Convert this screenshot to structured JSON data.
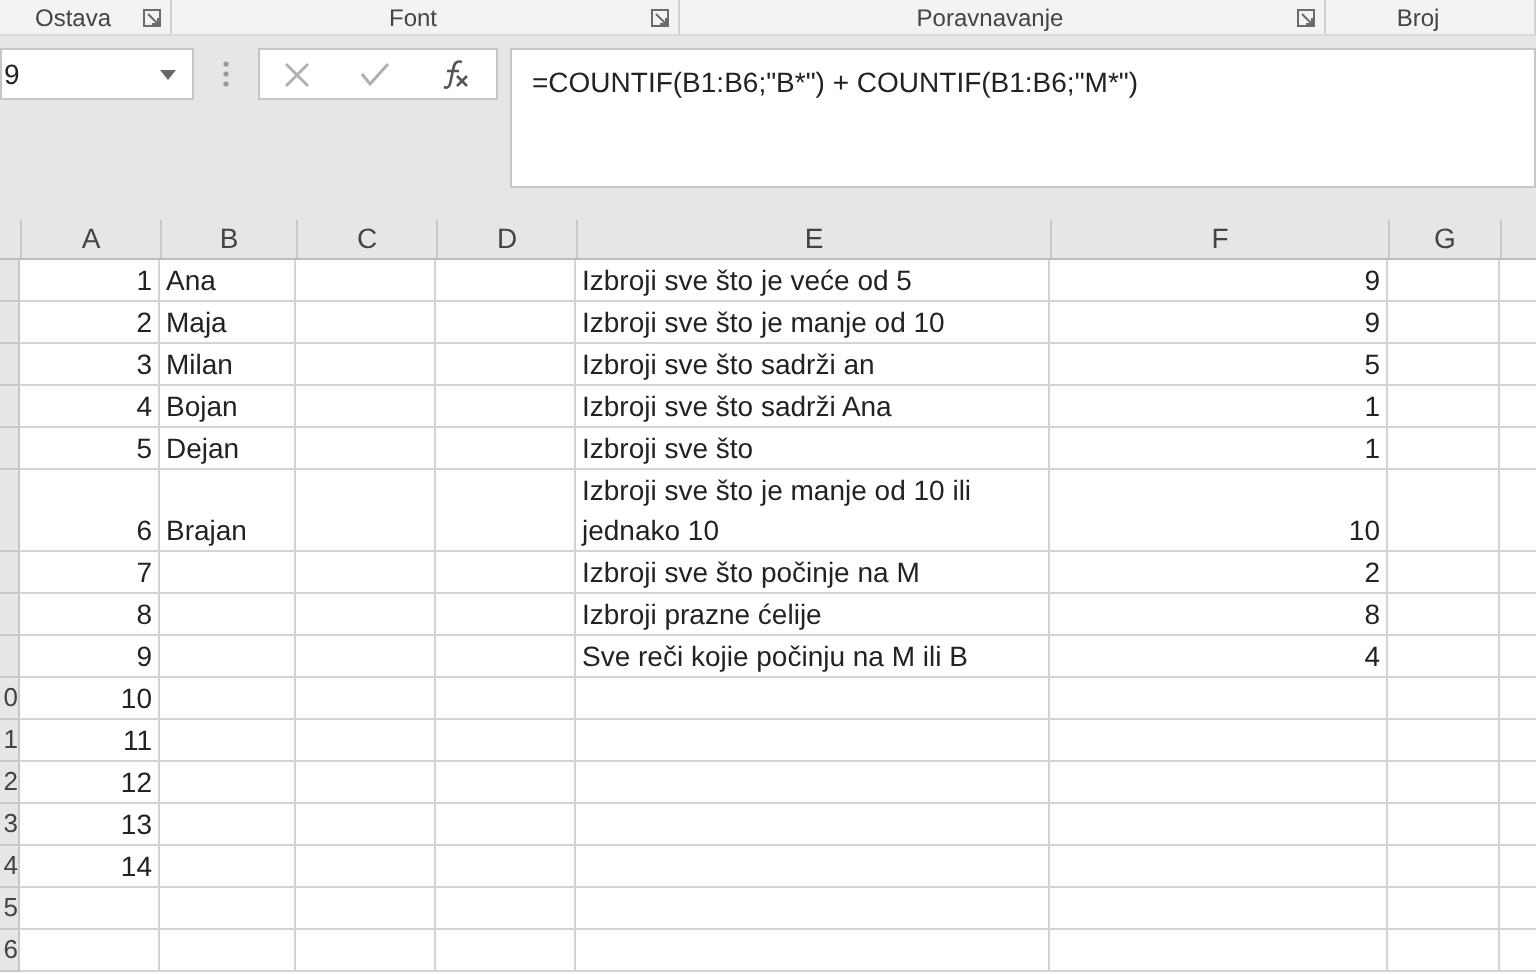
{
  "ribbon_groups": [
    {
      "label": "Ostava",
      "launcher": true
    },
    {
      "label": "Font",
      "launcher": true
    },
    {
      "label": "Poravnavanje",
      "launcher": true
    },
    {
      "label": "Broj",
      "launcher": false
    }
  ],
  "name_box": {
    "value": "9"
  },
  "formula_bar": {
    "value": "=COUNTIF(B1:B6;\"B*\") + COUNTIF(B1:B6;\"M*\")"
  },
  "columns": [
    "A",
    "B",
    "C",
    "D",
    "E",
    "F",
    "G"
  ],
  "rows": [
    {
      "a": "1",
      "b": "Ana",
      "e": "Izbroji sve što je veće od 5",
      "f": "9"
    },
    {
      "a": "2",
      "b": "Maja",
      "e": "Izbroji sve što je manje od 10",
      "f": "9"
    },
    {
      "a": "3",
      "b": "Milan",
      "e": "Izbroji sve što sadrži an",
      "f": "5"
    },
    {
      "a": "4",
      "b": "Bojan",
      "e": "Izbroji sve što sadrži Ana",
      "f": "1"
    },
    {
      "a": "5",
      "b": "Dejan",
      "e": "Izbroji sve što",
      "f": "1"
    },
    {
      "a": "6",
      "b": "Brajan",
      "e": "Izbroji sve što je manje od 10 ili jednako 10",
      "f": "10"
    },
    {
      "a": "7",
      "e": "Izbroji sve što počinje na M",
      "f": "2"
    },
    {
      "a": "8",
      "e": "Izbroji prazne ćelije",
      "f": "8"
    },
    {
      "a": "9",
      "e": "Sve reči kojie počinju na M ili B",
      "f": "4"
    },
    {
      "header": "0",
      "a": "10"
    },
    {
      "header": "1",
      "a": "11"
    },
    {
      "header": "2",
      "a": "12"
    },
    {
      "header": "3",
      "a": "13"
    },
    {
      "header": "4",
      "a": "14"
    },
    {
      "header": "5"
    },
    {
      "header": "6"
    }
  ]
}
